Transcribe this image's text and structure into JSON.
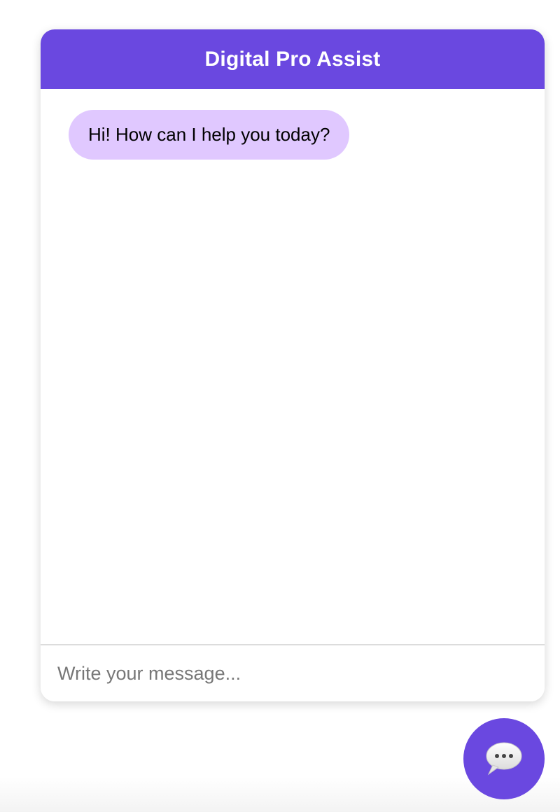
{
  "header": {
    "title": "Digital Pro Assist"
  },
  "messages": [
    {
      "sender": "bot",
      "text": "Hi! How can I help you today?"
    }
  ],
  "input": {
    "placeholder": "Write your message...",
    "value": ""
  },
  "launcher": {
    "icon": "speech-bubble-icon"
  },
  "colors": {
    "brand": "#6a48e0",
    "bot_bubble": "#e0c8ff"
  }
}
